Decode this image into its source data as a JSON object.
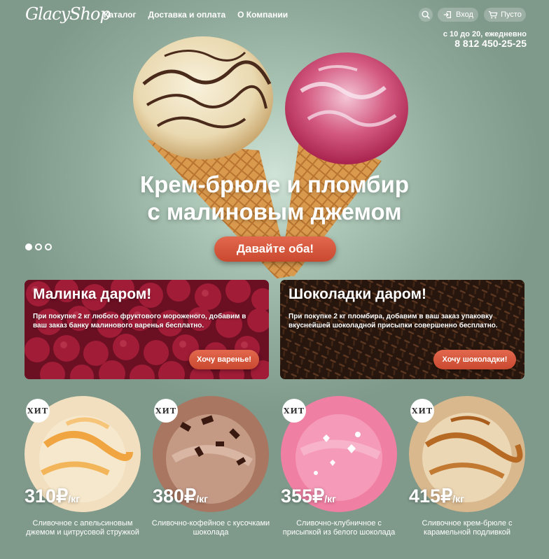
{
  "header": {
    "logo": "GlacyShop",
    "nav": [
      "Каталог",
      "Доставка и оплата",
      "О Компании"
    ],
    "search_icon": "search-icon",
    "login_label": "Вход",
    "cart_label": "Пусто",
    "hours": "с 10 до 20, ежедневно",
    "phone": "8 812 450-25-25"
  },
  "hero": {
    "title_line1": "Крем-брюле и пломбир",
    "title_line2": "с малиновым джемом",
    "cta": "Давайте оба!",
    "slides": 3,
    "active_slide": 1
  },
  "promos": [
    {
      "title": "Малинка даром!",
      "text": "При покупке 2 кг любого фруктового мороженого, добавим в ваш заказ банку малинового варенья бесплатно.",
      "button": "Хочу варенье!"
    },
    {
      "title": "Шоколадки даром!",
      "text": "При покупке 2 кг пломбира, добавим в ваш заказ упаковку вкуснейшей шоколадной присыпки совершенно бесплатно.",
      "button": "Хочу шоколадки!"
    }
  ],
  "products": [
    {
      "badge": "ХИТ",
      "price": "310₽",
      "unit": "/кг",
      "name": "Сливочное с апельсиновым джемом и цитрусовой стружкой"
    },
    {
      "badge": "ХИТ",
      "price": "380₽",
      "unit": "/кг",
      "name": "Сливочно-кофейное с кусочками шоколада"
    },
    {
      "badge": "ХИТ",
      "price": "355₽",
      "unit": "/кг",
      "name": "Сливочно-клубничное с присыпкой из белого шоколада"
    },
    {
      "badge": "ХИТ",
      "price": "415₽",
      "unit": "/кг",
      "name": "Сливочное крем-брюле с карамельной подливкой"
    }
  ],
  "colors": {
    "background": "#8fa99a",
    "accent": "#d4553a"
  }
}
